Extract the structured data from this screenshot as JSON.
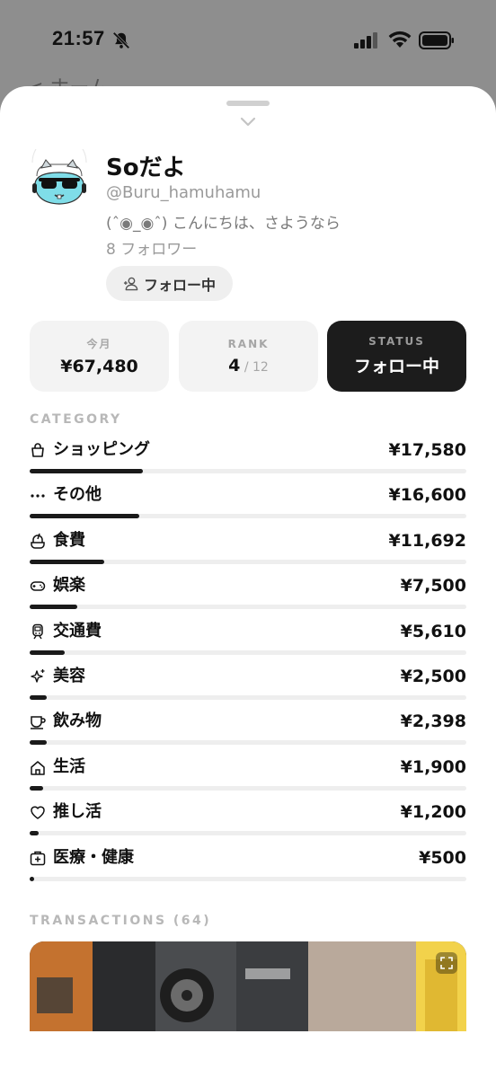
{
  "status_bar": {
    "time": "21:57"
  },
  "nav": {
    "back_label": "< ホーム"
  },
  "profile": {
    "name": "Soだよ",
    "handle": "@Buru_hamuhamu",
    "bio": "(ˆ◉_◉ˆ) こんにちは、さようなら",
    "followers": "8 フォロワー",
    "follow_button": "フォロー中"
  },
  "stats": [
    {
      "label": "今月",
      "value": "¥67,480"
    },
    {
      "label": "RANK",
      "value": "4",
      "sub": " / 12"
    },
    {
      "label": "STATUS",
      "value": "フォロー中"
    }
  ],
  "category_label": "CATEGORY",
  "categories": [
    {
      "icon": "shopping-bag-icon",
      "name": "ショッピング",
      "amount": "¥17,580",
      "ratio": 0.26
    },
    {
      "icon": "more-dots-icon",
      "name": "その他",
      "amount": "¥16,600",
      "ratio": 0.25
    },
    {
      "icon": "food-icon",
      "name": "食費",
      "amount": "¥11,692",
      "ratio": 0.17
    },
    {
      "icon": "gamepad-icon",
      "name": "娯楽",
      "amount": "¥7,500",
      "ratio": 0.11
    },
    {
      "icon": "train-icon",
      "name": "交通費",
      "amount": "¥5,610",
      "ratio": 0.08
    },
    {
      "icon": "sparkles-icon",
      "name": "美容",
      "amount": "¥2,500",
      "ratio": 0.04
    },
    {
      "icon": "cup-icon",
      "name": "飲み物",
      "amount": "¥2,398",
      "ratio": 0.04
    },
    {
      "icon": "home-icon",
      "name": "生活",
      "amount": "¥1,900",
      "ratio": 0.03
    },
    {
      "icon": "heart-icon",
      "name": "推し活",
      "amount": "¥1,200",
      "ratio": 0.02
    },
    {
      "icon": "medical-kit-icon",
      "name": "医療・健康",
      "amount": "¥500",
      "ratio": 0.01
    }
  ],
  "transactions_label": "TRANSACTIONS (64)",
  "colors": {
    "accent_dark": "#1c1c1c",
    "bar_fill": "#1a1a1a",
    "track": "#eeeeee"
  }
}
